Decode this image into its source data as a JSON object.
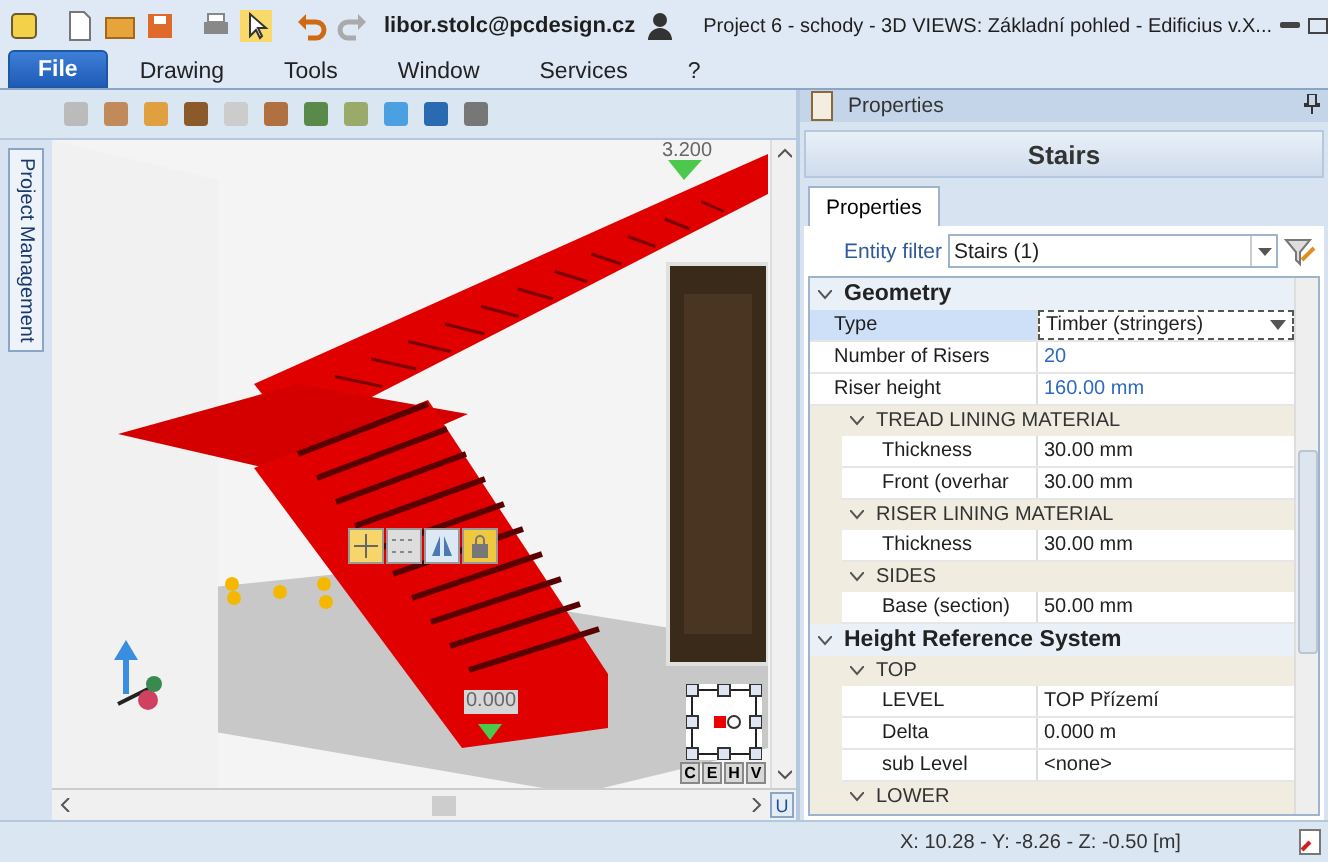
{
  "title_bar": {
    "user": "libor.stolc@pcdesign.cz",
    "title": "Project 6 - schody -  3D VIEWS: Základní pohled - Edificius v.X..."
  },
  "ribbon_tabs": [
    {
      "label": "File",
      "selected": true
    },
    {
      "label": "Drawing",
      "selected": false
    },
    {
      "label": "Tools",
      "selected": false
    },
    {
      "label": "Window",
      "selected": false
    },
    {
      "label": "Services",
      "selected": false
    },
    {
      "label": "?",
      "selected": false
    }
  ],
  "side_tab": {
    "label": "Project Management"
  },
  "viewport": {
    "top_level": "3.200",
    "bottom_level": "0.000",
    "view_buttons": [
      "C",
      "E",
      "H",
      "V"
    ],
    "corner_button": "U"
  },
  "properties": {
    "panel_title": "Properties",
    "object": "Stairs",
    "tabs": [
      {
        "label": "Properties",
        "selected": true
      }
    ],
    "entity_filter": {
      "label": "Entity filter",
      "value": "Stairs (1)"
    },
    "sections": [
      {
        "title": "Geometry",
        "expanded": true,
        "items": [
          {
            "kind": "property",
            "label": "Type",
            "value": "Timber (stringers)",
            "selected": true,
            "modified": false
          },
          {
            "kind": "property",
            "label": "Number of Risers",
            "value": "20",
            "selected": false,
            "modified": true
          },
          {
            "kind": "property",
            "label": "Riser height",
            "value": "160.00 mm",
            "selected": false,
            "modified": true
          },
          {
            "kind": "group",
            "label": "TREAD LINING MATERIAL",
            "expanded": true
          },
          {
            "kind": "subproperty",
            "label": "Thickness",
            "value": "30.00 mm",
            "selected": false,
            "modified": false
          },
          {
            "kind": "subproperty",
            "label": "Front (overhar",
            "value": "30.00 mm",
            "selected": false,
            "modified": false
          },
          {
            "kind": "group",
            "label": "RISER LINING MATERIAL",
            "expanded": true
          },
          {
            "kind": "subproperty",
            "label": "Thickness",
            "value": "30.00 mm",
            "selected": false,
            "modified": false
          },
          {
            "kind": "group",
            "label": "SIDES",
            "expanded": true
          },
          {
            "kind": "subproperty",
            "label": "Base (section)",
            "value": "50.00 mm",
            "selected": false,
            "modified": false
          }
        ]
      },
      {
        "title": "Height Reference System",
        "expanded": true,
        "items": [
          {
            "kind": "group",
            "label": "TOP",
            "expanded": true
          },
          {
            "kind": "subproperty",
            "label": "LEVEL",
            "value": "TOP Přízemí",
            "selected": false,
            "modified": false
          },
          {
            "kind": "subproperty",
            "label": "Delta",
            "value": "0.000 m",
            "selected": false,
            "modified": false
          },
          {
            "kind": "subproperty",
            "label": "sub Level",
            "value": "<none>",
            "selected": false,
            "modified": false
          },
          {
            "kind": "group",
            "label": "LOWER",
            "expanded": true
          }
        ]
      }
    ]
  },
  "status_bar": {
    "coordinates": "X: 10.28 - Y: -8.26 - Z: -0.50 [m]"
  }
}
